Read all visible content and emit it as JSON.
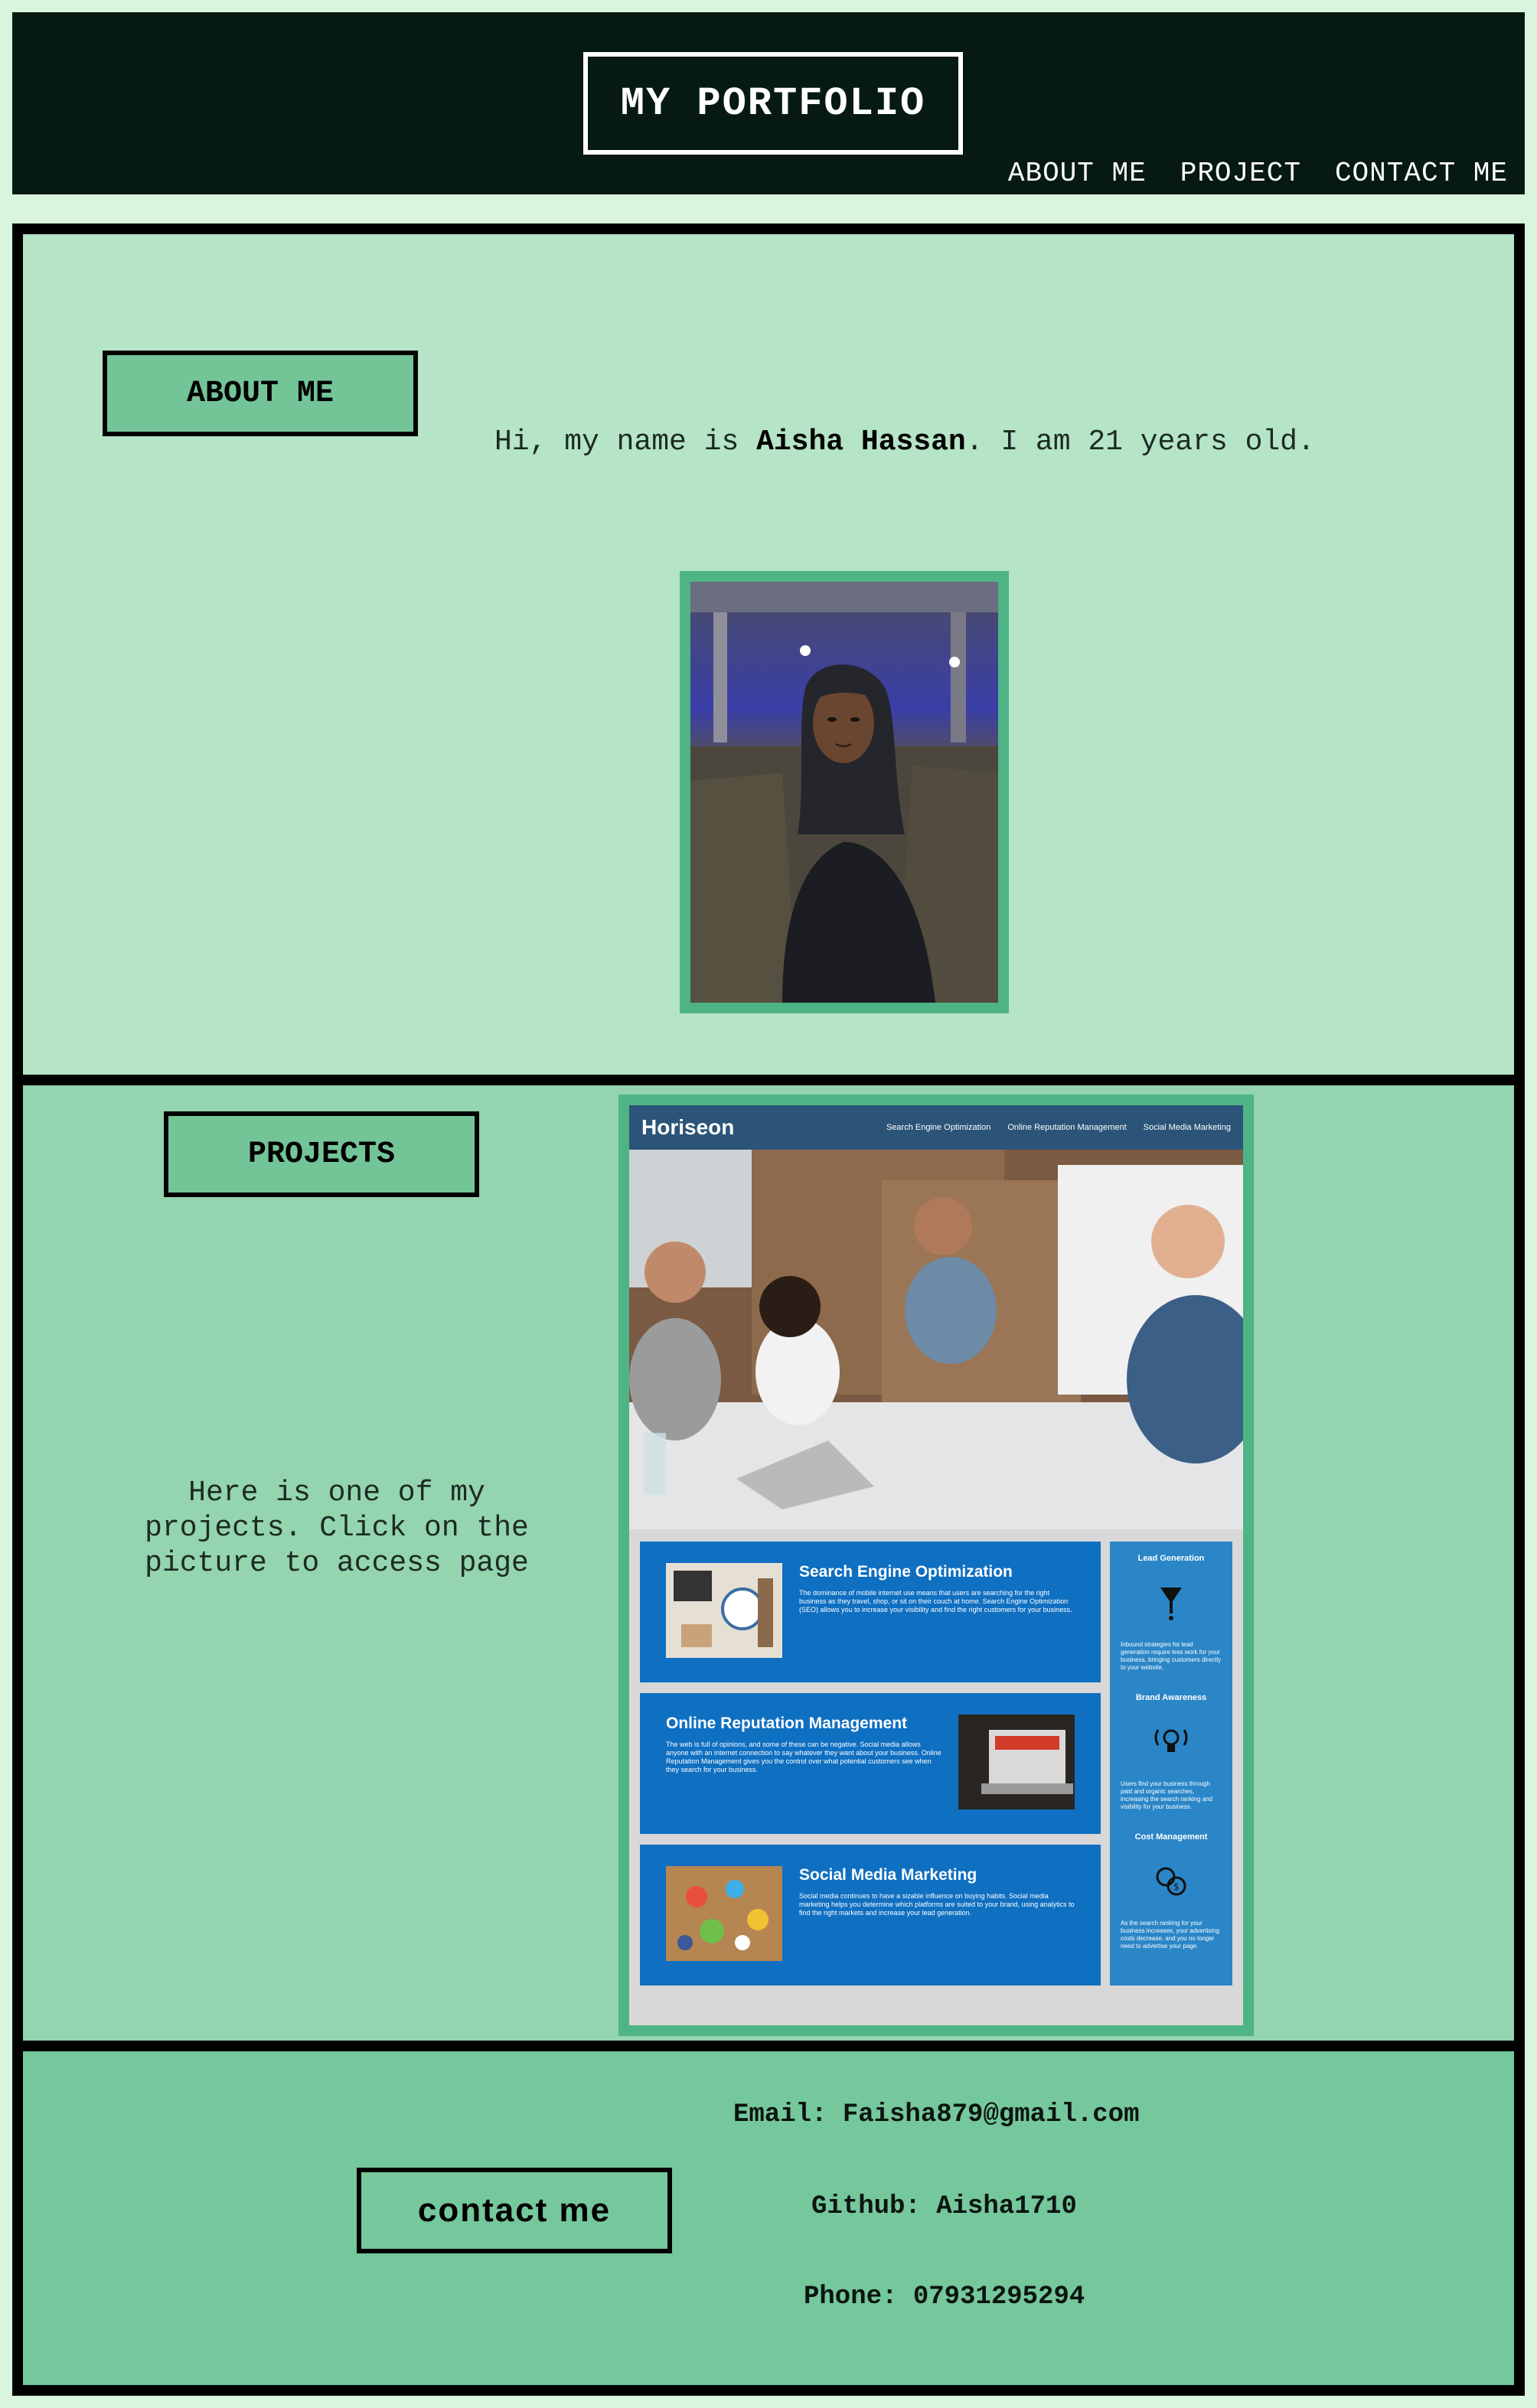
{
  "header": {
    "logo": "MY PORTFOLIO",
    "nav": [
      "ABOUT ME",
      "PROJECT",
      "CONTACT ME"
    ]
  },
  "about": {
    "heading": "ABOUT ME",
    "intro_prefix": "Hi, my name is ",
    "intro_name": "Aisha Hassan",
    "intro_suffix": ". I am 21 years old."
  },
  "projects": {
    "heading": "PROJECTS",
    "description": "Here is one of my projects. Click on the picture to access page",
    "screenshot": {
      "brand": "Horiseon",
      "nav": [
        "Search Engine Optimization",
        "Online Reputation Management",
        "Social Media Marketing"
      ],
      "cards": [
        {
          "title": "Search Engine Optimization",
          "text": "The dominance of mobile internet use means that users are searching for the right business as they travel, shop, or sit on their couch at home. Search Engine Optimization (SEO) allows you to increase your visibility and find the right customers for your business."
        },
        {
          "title": "Online Reputation Management",
          "text": "The web is full of opinions, and some of these can be negative. Social media allows anyone with an internet connection to say whatever they want about your business. Online Reputation Management gives you the control over what potential customers see when they search for your business."
        },
        {
          "title": "Social Media Marketing",
          "text": "Social media continues to have a sizable influence on buying habits. Social media marketing helps you determine which platforms are suited to your brand, using analytics to find the right markets and increase your lead generation."
        }
      ],
      "sidebar": [
        {
          "title": "Lead Generation",
          "text": "Inbound strategies for lead generation require less work for your business, bringing customers directly to your website."
        },
        {
          "title": "Brand Awareness",
          "text": "Users find your business through paid and organic searches, increasing the search ranking and visibility for your business."
        },
        {
          "title": "Cost Management",
          "text": "As the search ranking for your business increases, your advertising costs decrease, and you no longer need to advertise your page."
        }
      ]
    }
  },
  "contact": {
    "heading": "contact me",
    "email": "Email: Faisha879@gmail.com",
    "github": "Github: Aisha1710",
    "phone": "Phone: 07931295294"
  },
  "colors": {
    "header_bg": "#061a13",
    "about_bg": "#b5e4c6",
    "projects_bg": "#94d4ae",
    "contact_bg": "#75c79c",
    "accent_border": "#4fb485"
  }
}
